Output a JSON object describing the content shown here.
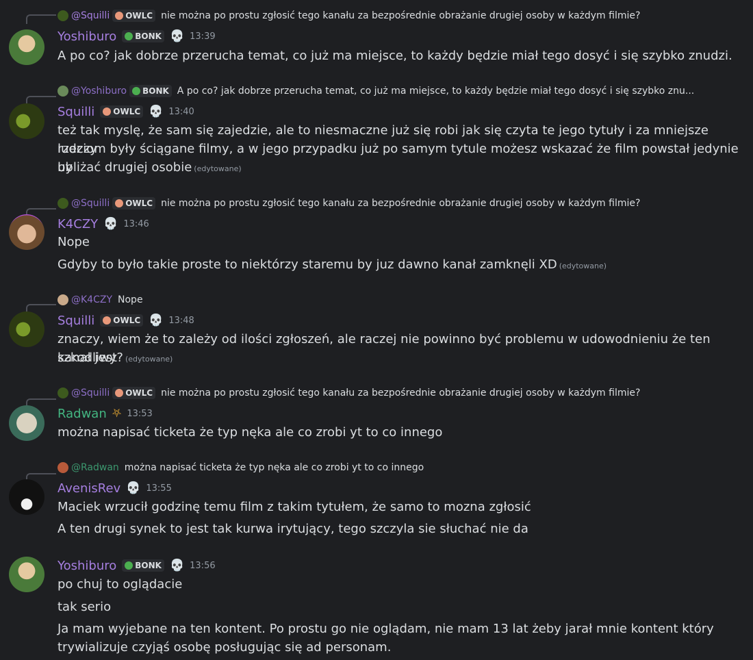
{
  "colors": {
    "background": "#1e1f22",
    "username_purple": "#a67fe0",
    "username_green": "#43b581",
    "text": "#dbdee1",
    "muted": "#949ba4"
  },
  "messages": [
    {
      "reply": {
        "name": "@Squilli",
        "tag": "OWLC",
        "text": "nie można po prostu zgłosić tego kanału za bezpośrednie obrażanie drugiej osoby w każdym filmie?"
      },
      "author": "Yoshiburo",
      "tag": "BONK",
      "time": "13:39",
      "lines": [
        "A po co? jak dobrze przerucha temat, co już ma miejsce, to każdy będzie miał tego dosyć i się szybko znudzi."
      ]
    },
    {
      "reply": {
        "name": "@Yoshiburo",
        "tag": "BONK",
        "text": "A po co? jak dobrze przerucha temat, co już ma miejsce, to każdy będzie miał tego dosyć i się szybko znu..."
      },
      "author": "Squilli",
      "tag": "OWLC",
      "time": "13:40",
      "lines": [
        "też tak myslę, że sam się zajedzie, ale to niesmaczne już się robi jak się czyta te jego tytuły i za mniejsze rzeczy",
        "ludziom były ściągane filmy, a w jego przypadku już po samym tytule możesz wskazać że film powstał jedynie by",
        "ubliżać drugiej osobie"
      ],
      "edited": "(edytowane)"
    },
    {
      "reply": {
        "name": "@Squilli",
        "tag": "OWLC",
        "text": "nie można po prostu zgłosić tego kanału za bezpośrednie obrażanie drugiej osoby w każdym filmie?"
      },
      "author": "K4CZY",
      "time": "13:46",
      "lines": [
        "Nope",
        "Gdyby to było takie proste to niektórzy staremu by juz dawno kanał zamknęli XD"
      ],
      "edited": "(edytowane)"
    },
    {
      "reply": {
        "name": "@K4CZY",
        "text": "Nope"
      },
      "author": "Squilli",
      "tag": "OWLC",
      "time": "13:48",
      "lines": [
        "znaczy, wiem że to zależy od ilości zgłoszeń, ale raczej nie powinno być problemu w udowodnieniu że ten kanał jest",
        "szkodliwy?"
      ],
      "edited": "(edytowane)"
    },
    {
      "reply": {
        "name": "@Squilli",
        "tag": "OWLC",
        "text": "nie można po prostu zgłosić tego kanału za bezpośrednie obrażanie drugiej osoby w każdym filmie?"
      },
      "author": "Radwan",
      "time": "13:53",
      "lines": [
        "można napisać ticketa że typ nęka ale co zrobi yt to co innego"
      ]
    },
    {
      "reply": {
        "name": "@Radwan",
        "text": "można napisać ticketa że typ nęka ale co zrobi yt to co innego"
      },
      "author": "AvenisRev",
      "time": "13:55",
      "lines": [
        "Maciek wrzucił godzinę temu film z takim tytułem, że samo to mozna zgłosić",
        "A ten drugi synek to jest tak kurwa irytujący, tego szczyla sie słuchać nie da"
      ]
    },
    {
      "author": "Yoshiburo",
      "tag": "BONK",
      "time": "13:56",
      "lines": [
        "po chuj to oglądacie",
        "tak serio",
        "Ja mam wyjebane na ten kontent. Po prostu go nie oglądam, nie mam 13 lat żeby jarał mnie kontent który",
        "trywializuje czyjąś osobę posługując się ad personam."
      ]
    }
  ]
}
